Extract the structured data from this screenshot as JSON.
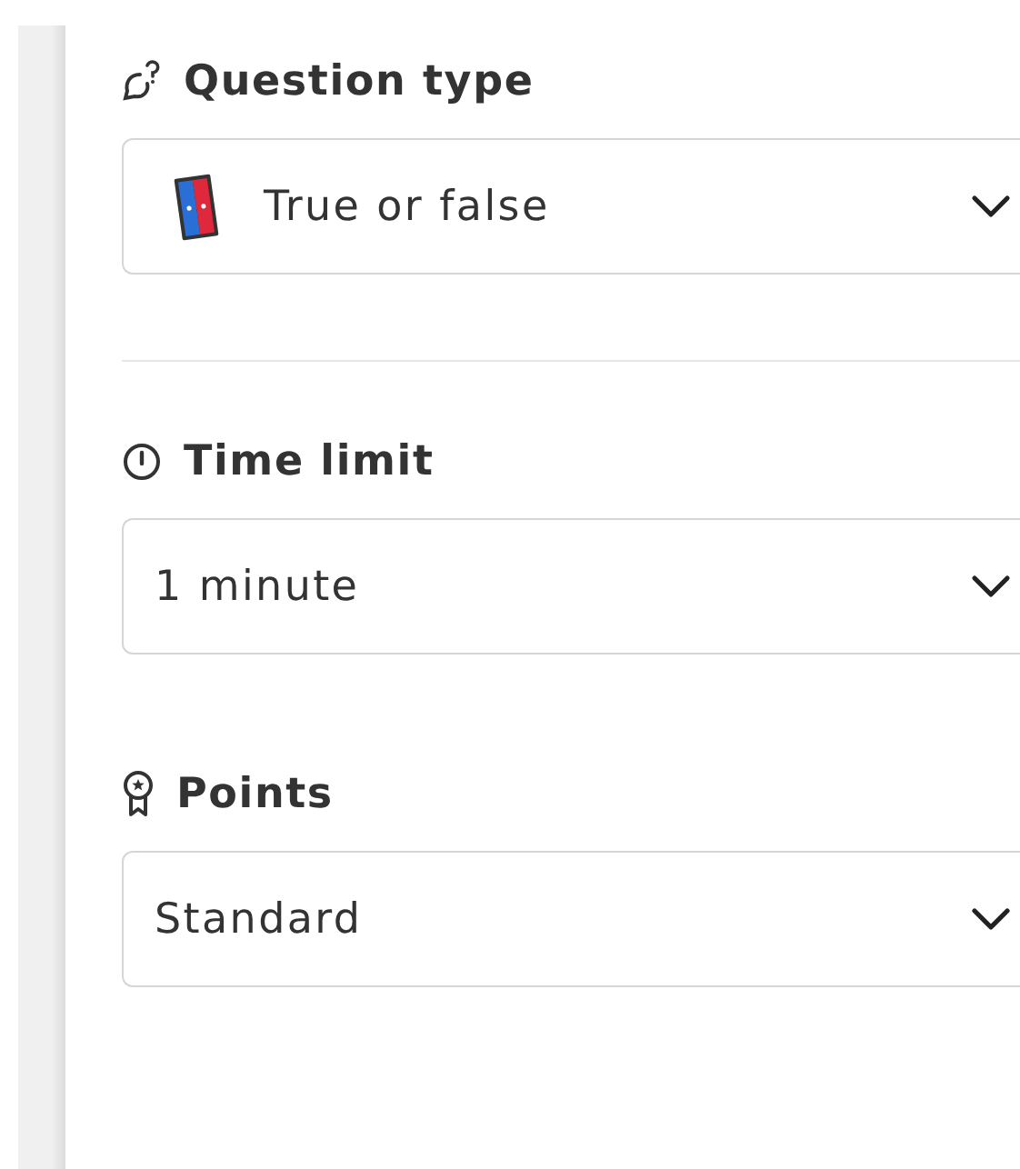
{
  "sections": [
    {
      "kind": "question-type",
      "heading": "Question type",
      "dropdown": {
        "value": "True or false",
        "kind": "with-picture"
      }
    },
    {
      "kind": "time-limit",
      "heading": "Time limit",
      "dropdown": {
        "value": "1 minute",
        "kind": "plain"
      }
    },
    {
      "kind": "points",
      "heading": "Points",
      "dropdown": {
        "value": "Standard",
        "kind": "plain"
      }
    }
  ]
}
